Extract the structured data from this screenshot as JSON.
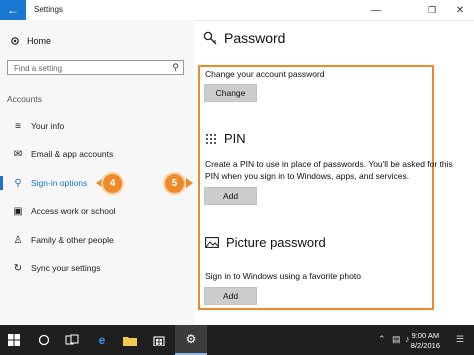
{
  "window": {
    "title": "Settings",
    "back_icon": "←",
    "minimize_icon": "—",
    "maximize_icon": "❐",
    "close_icon": "✕"
  },
  "sidebar": {
    "home_label": "Home",
    "search_placeholder": "Find a setting",
    "section": "Accounts",
    "items": [
      {
        "label": "Your info",
        "icon": "≡"
      },
      {
        "label": "Email & app accounts",
        "icon": "✉"
      },
      {
        "label": "Sign-in options",
        "icon": "⚲"
      },
      {
        "label": "Access work or school",
        "icon": "▣"
      },
      {
        "label": "Family & other people",
        "icon": "♙"
      },
      {
        "label": "Sync your settings",
        "icon": "↻"
      }
    ]
  },
  "callouts": {
    "left": "4",
    "right": "5"
  },
  "main": {
    "title": "Password",
    "password_desc": "Change your account password",
    "change_button": "Change",
    "pin_title": "PIN",
    "pin_desc_line1": "Create a PIN to use in place of passwords. You'll be asked for this",
    "pin_desc_line2": "PIN when you sign in to Windows, apps, and services.",
    "pin_add_button": "Add",
    "picture_title": "Picture password",
    "picture_desc": "Sign in to Windows using a favorite photo",
    "picture_add_button": "Add"
  },
  "taskbar": {
    "time": "9:00 AM",
    "date": "8/2/2016"
  },
  "colors": {
    "accent": "#1e73c8",
    "callout": "#ee8a2a",
    "taskbar": "#1f1f1f"
  }
}
